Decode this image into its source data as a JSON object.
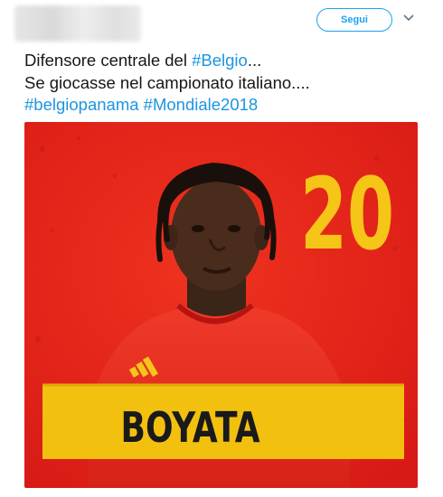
{
  "header": {
    "follow_label": "Segui",
    "menu_icon": "chevron-down-icon"
  },
  "tweet": {
    "line1_text": "Difensore centrale del ",
    "line1_hashtag": "#Belgio",
    "line1_suffix": "...",
    "line2_text": "Se giocasse nel campionato italiano....",
    "hashtag1": "#belgiopanama",
    "hashtag2": "#Mondiale2018"
  },
  "media": {
    "player_number": "20",
    "player_name": "BOYATA",
    "background_color": "#e8231e",
    "number_color": "#f5c518",
    "banner_color": "#f2c10f"
  }
}
